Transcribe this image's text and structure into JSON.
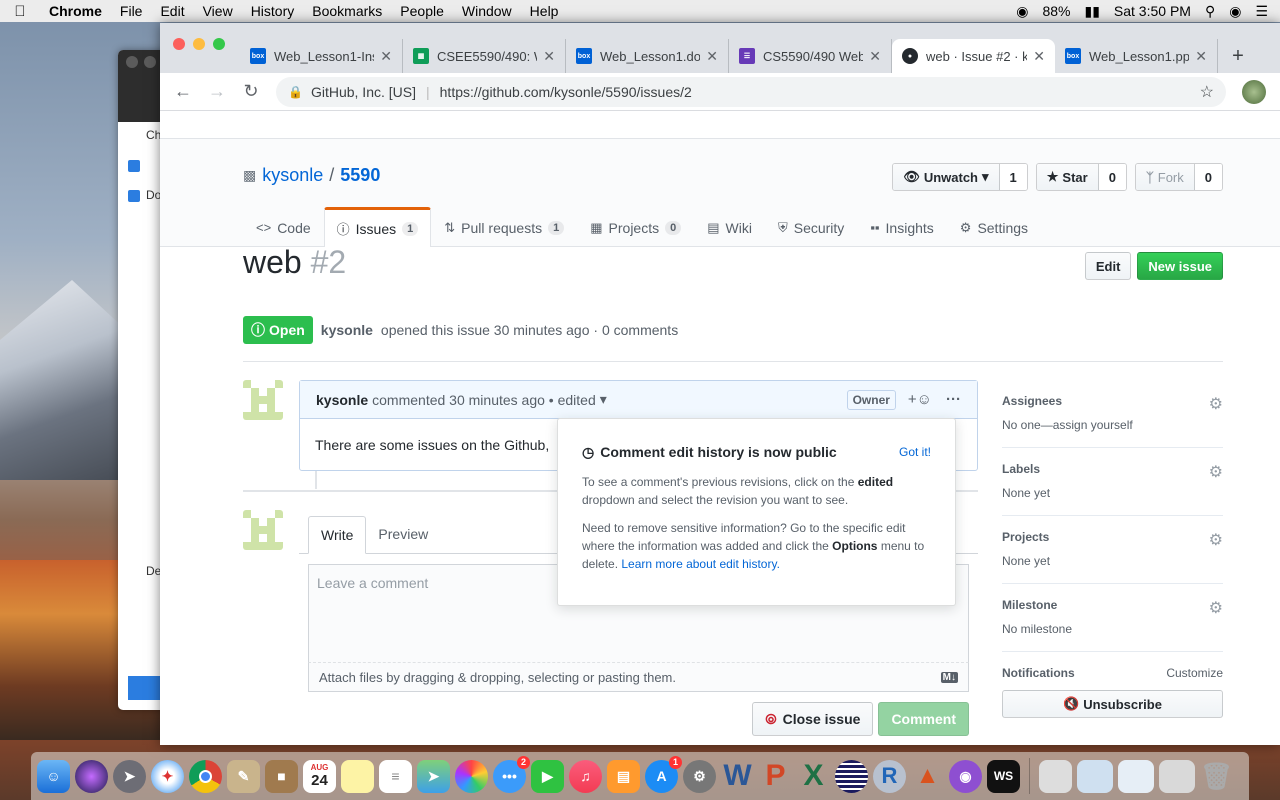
{
  "menubar": {
    "app": "Chrome",
    "items": [
      "File",
      "Edit",
      "View",
      "History",
      "Bookmarks",
      "People",
      "Window",
      "Help"
    ],
    "battery": "88%",
    "clock": "Sat 3:50 PM"
  },
  "bgwindow": {
    "t1": "Ch",
    "t2": "Do",
    "t3": "Desc"
  },
  "tabs": [
    {
      "title": "Web_Lesson1-Ins",
      "icon": "box-icon",
      "color": "#0061d5"
    },
    {
      "title": "CSEE5590/490: W",
      "icon": "sheets-icon",
      "color": "#0f9d58"
    },
    {
      "title": "Web_Lesson1.doc",
      "icon": "box-icon",
      "color": "#0061d5"
    },
    {
      "title": "CS5590/490 Web",
      "icon": "forms-icon",
      "color": "#673ab7"
    },
    {
      "title": "web · Issue #2 · k",
      "icon": "github-icon",
      "color": "#24292e"
    },
    {
      "title": "Web_Lesson1.ppt",
      "icon": "box-icon",
      "color": "#0061d5"
    }
  ],
  "omnibox": {
    "org": "GitHub, Inc. [US]",
    "url": "https://github.com/kysonle/5590/issues/2"
  },
  "repo": {
    "owner": "kysonle",
    "name": "5590",
    "unwatch": "Unwatch",
    "watch_count": "1",
    "star": "Star",
    "star_count": "0",
    "fork": "Fork",
    "fork_count": "0"
  },
  "nav": [
    {
      "label": "Code",
      "icon": "code-icon"
    },
    {
      "label": "Issues",
      "count": "1",
      "icon": "issue-icon"
    },
    {
      "label": "Pull requests",
      "count": "1",
      "icon": "pr-icon"
    },
    {
      "label": "Projects",
      "count": "0",
      "icon": "project-icon"
    },
    {
      "label": "Wiki",
      "icon": "book-icon"
    },
    {
      "label": "Security",
      "icon": "shield-icon"
    },
    {
      "label": "Insights",
      "icon": "graph-icon"
    },
    {
      "label": "Settings",
      "icon": "gear-icon"
    }
  ],
  "issue": {
    "title": "web",
    "number": "#2",
    "edit": "Edit",
    "new_issue": "New issue",
    "state": "Open",
    "author": "kysonle",
    "meta": "opened this issue 30 minutes ago · 0 comments"
  },
  "comment": {
    "author": "kysonle",
    "meta": "commented 30 minutes ago • edited",
    "badge": "Owner",
    "body": "There are some issues on the Github,"
  },
  "newcomment": {
    "write": "Write",
    "preview": "Preview",
    "placeholder": "Leave a comment",
    "attach": "Attach files by dragging & dropping, selecting or pasting them.",
    "close": "Close issue",
    "submit": "Comment"
  },
  "popover": {
    "title": "Comment edit history is now public",
    "got": "Got it!",
    "p1a": "To see a comment's previous revisions, click on the ",
    "p1b": "edited",
    "p1c": " dropdown and select the revision you want to see.",
    "p2a": "Need to remove sensitive information? Go to the specific edit where the information was added and click the ",
    "p2b": "Options",
    "p2c": " menu to delete. ",
    "p2link": "Learn more about edit history."
  },
  "sidebar": {
    "assignees": "Assignees",
    "assignees_v": "No one—assign yourself",
    "labels": "Labels",
    "labels_v": "None yet",
    "projects": "Projects",
    "projects_v": "None yet",
    "milestone": "Milestone",
    "milestone_v": "No milestone",
    "notifications": "Notifications",
    "customize": "Customize",
    "unsubscribe": "Unsubscribe"
  },
  "dock": {
    "calendar_month": "AUG",
    "calendar_day": "24",
    "mail_badge": "2",
    "appstore_badge": "1"
  }
}
